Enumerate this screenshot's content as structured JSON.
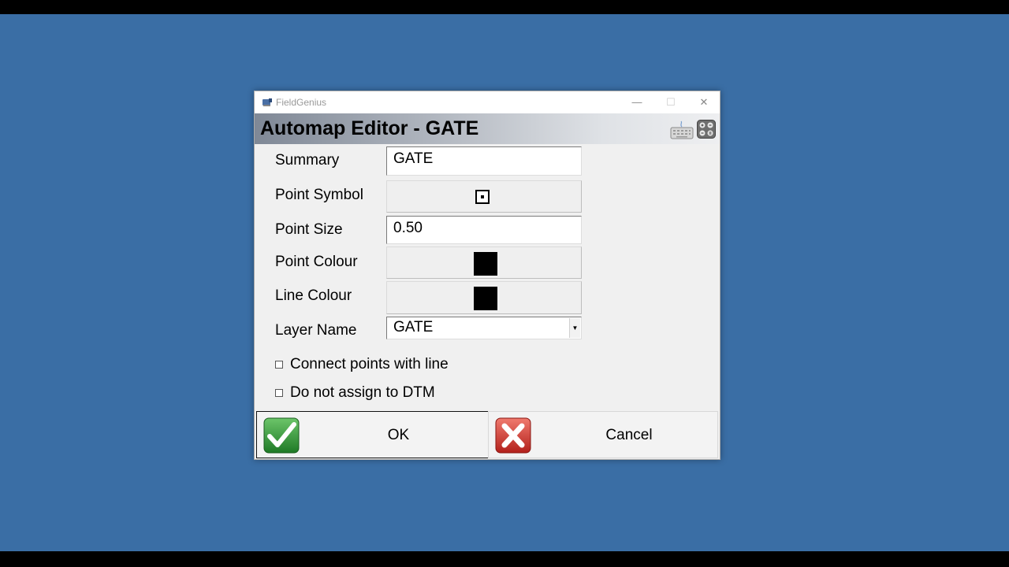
{
  "window": {
    "app_title": "FieldGenius",
    "controls": {
      "minimize": "—",
      "maximize": "☐",
      "close": "✕"
    }
  },
  "header": {
    "title": "Automap Editor - GATE",
    "icons": [
      "keyboard-icon",
      "calculator-icon"
    ]
  },
  "form": {
    "summary": {
      "label": "Summary",
      "value": "GATE"
    },
    "point_symbol": {
      "label": "Point Symbol",
      "symbol": "square-dot-symbol"
    },
    "point_size": {
      "label": "Point Size",
      "value": "0.50"
    },
    "point_colour": {
      "label": "Point Colour",
      "color": "#000000"
    },
    "line_colour": {
      "label": "Line Colour",
      "color": "#000000"
    },
    "layer_name": {
      "label": "Layer Name",
      "value": "GATE"
    }
  },
  "options": {
    "connect_points": {
      "label": "Connect points with line",
      "checked": false
    },
    "no_dtm": {
      "label": "Do not assign to DTM",
      "checked": false
    }
  },
  "buttons": {
    "ok": {
      "label": "OK",
      "icon": "checkmark-icon"
    },
    "cancel": {
      "label": "Cancel",
      "icon": "x-icon"
    }
  },
  "colors": {
    "desktop": "#3a6ea5",
    "ok_icon": "#3aa33a",
    "cancel_icon": "#d9302c"
  }
}
